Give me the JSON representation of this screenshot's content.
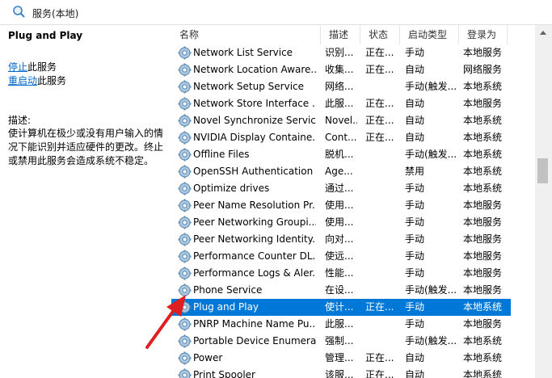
{
  "window": {
    "title": "服务(本地)",
    "title_icon": "search-icon"
  },
  "details": {
    "service_title": "Plug and Play",
    "stop_link": "停止",
    "stop_suffix": "此服务",
    "restart_link": "重启动",
    "restart_suffix": "此服务",
    "description_label": "描述:",
    "description_text": "使计算机在极少或没有用户输入的情况下能识别并适应硬件的更改。终止或禁用此服务会造成系统不稳定。"
  },
  "columns": [
    "名称",
    "描述",
    "状态",
    "启动类型",
    "登录为"
  ],
  "services": [
    {
      "name": "Network List Service",
      "desc": "识别...",
      "status": "正在...",
      "startup": "手动",
      "logon": "本地服务"
    },
    {
      "name": "Network Location Aware...",
      "desc": "收集...",
      "status": "正在...",
      "startup": "自动",
      "logon": "网络服务"
    },
    {
      "name": "Network Setup Service",
      "desc": "网络...",
      "status": "",
      "startup": "手动(触发...",
      "logon": "本地系统"
    },
    {
      "name": "Network Store Interface ...",
      "desc": "此服...",
      "status": "正在...",
      "startup": "自动",
      "logon": "本地服务"
    },
    {
      "name": "Novel Synchronize Service",
      "desc": "Novel...",
      "status": "正在...",
      "startup": "自动",
      "logon": "本地系统"
    },
    {
      "name": "NVIDIA Display Containe...",
      "desc": "Cont...",
      "status": "正在...",
      "startup": "自动",
      "logon": "本地系统"
    },
    {
      "name": "Offline Files",
      "desc": "脱机...",
      "status": "",
      "startup": "手动(触发...",
      "logon": "本地系统"
    },
    {
      "name": "OpenSSH Authentication ...",
      "desc": "Age...",
      "status": "",
      "startup": "禁用",
      "logon": "本地系统"
    },
    {
      "name": "Optimize drives",
      "desc": "通过...",
      "status": "",
      "startup": "手动",
      "logon": "本地系统"
    },
    {
      "name": "Peer Name Resolution Pr...",
      "desc": "使用...",
      "status": "",
      "startup": "手动",
      "logon": "本地服务"
    },
    {
      "name": "Peer Networking Groupi...",
      "desc": "使用...",
      "status": "",
      "startup": "手动",
      "logon": "本地服务"
    },
    {
      "name": "Peer Networking Identity...",
      "desc": "向对...",
      "status": "",
      "startup": "手动",
      "logon": "本地服务"
    },
    {
      "name": "Performance Counter DL...",
      "desc": "使远...",
      "status": "",
      "startup": "手动",
      "logon": "本地服务"
    },
    {
      "name": "Performance Logs & Aler...",
      "desc": "性能...",
      "status": "",
      "startup": "手动",
      "logon": "本地服务"
    },
    {
      "name": "Phone Service",
      "desc": "在设...",
      "status": "",
      "startup": "手动(触发...",
      "logon": "本地服务"
    },
    {
      "name": "Plug and Play",
      "desc": "使计...",
      "status": "正在...",
      "startup": "手动",
      "logon": "本地系统",
      "selected": true
    },
    {
      "name": "PNRP Machine Name Pu...",
      "desc": "此服...",
      "status": "",
      "startup": "手动",
      "logon": "本地服务"
    },
    {
      "name": "Portable Device Enumera...",
      "desc": "强制...",
      "status": "",
      "startup": "手动(触发...",
      "logon": "本地系统"
    },
    {
      "name": "Power",
      "desc": "管理...",
      "status": "正在...",
      "startup": "自动",
      "logon": "本地系统"
    },
    {
      "name": "Print Spooler",
      "desc": "该服...",
      "status": "正在...",
      "startup": "自动",
      "logon": "本地系统"
    }
  ],
  "colors": {
    "selection": "#0078d7",
    "link": "#0066cc",
    "annotation_arrow": "#e02020"
  }
}
